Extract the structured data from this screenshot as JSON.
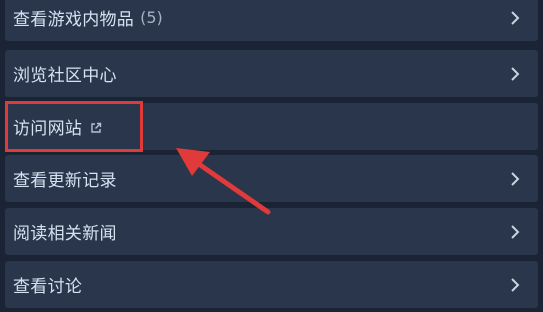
{
  "menu": {
    "items": [
      {
        "label": "查看游戏内物品",
        "count": "(5)",
        "has_chevron": true
      },
      {
        "label": "浏览社区中心",
        "count": "",
        "has_chevron": true
      },
      {
        "label": "访问网站",
        "count": "",
        "has_chevron": false,
        "icon": "external-link-icon"
      },
      {
        "label": "查看更新记录",
        "count": "",
        "has_chevron": true
      },
      {
        "label": "阅读相关新闻",
        "count": "",
        "has_chevron": true
      },
      {
        "label": "查看讨论",
        "count": "",
        "has_chevron": true
      }
    ]
  },
  "colors": {
    "background": "#1b2434",
    "row": "#29364b",
    "text": "#d6e2f2",
    "annotation": "#e03a3a"
  },
  "annotation": {
    "highlight_target": "访问网站",
    "arrow_icon": "red-arrow-icon"
  }
}
